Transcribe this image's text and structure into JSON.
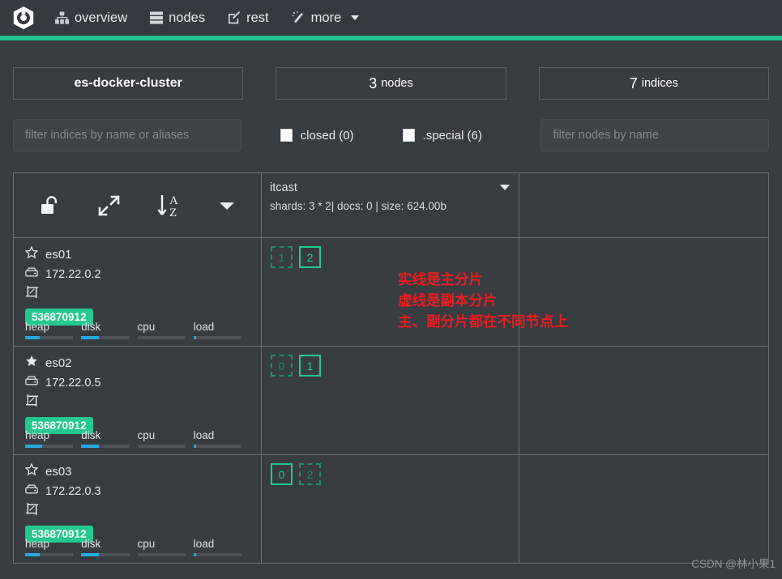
{
  "header": {
    "logo_alt": "cerebro-logo",
    "nav": [
      {
        "icon": "sitemap-icon",
        "label": "overview"
      },
      {
        "icon": "server-list-icon",
        "label": "nodes"
      },
      {
        "icon": "edit-square-icon",
        "label": "rest"
      },
      {
        "icon": "magic-wand-icon",
        "label": "more",
        "has_caret": true
      }
    ],
    "accent_color": "#1cbf8d"
  },
  "stats": {
    "cluster_name": "es-docker-cluster",
    "nodes_count": "3",
    "nodes_label": "nodes",
    "indices_count": "7",
    "indices_label": "indices"
  },
  "filters": {
    "indices_placeholder": "filter indices by name or aliases",
    "nodes_placeholder": "filter nodes by name",
    "indices_value": "",
    "nodes_value": "",
    "checkboxes": [
      {
        "label": "closed (0)",
        "checked": false
      },
      {
        "label": ".special (6)",
        "checked": false
      }
    ]
  },
  "toolbar": {
    "buttons": [
      {
        "icon": "unlock-icon",
        "name": "toggle-lock-button"
      },
      {
        "icon": "expand-arrows-icon",
        "name": "expand-button"
      },
      {
        "icon": "sort-az-icon",
        "name": "sort-az-button"
      },
      {
        "icon": "caret-down-icon",
        "name": "more-options-button"
      }
    ]
  },
  "index": {
    "name": "itcast",
    "meta": "shards: 3 * 2| docs: 0 | size: 624.00b"
  },
  "nodes": [
    {
      "name": "es01",
      "ip": "172.22.0.2",
      "is_master": false,
      "memory": "536870912",
      "metrics": [
        {
          "label": "heap",
          "pct": 30
        },
        {
          "label": "disk",
          "pct": 36
        },
        {
          "label": "cpu",
          "pct": 0
        },
        {
          "label": "load",
          "pct": 6
        }
      ],
      "shards": [
        {
          "id": "1",
          "type": "replica"
        },
        {
          "id": "2",
          "type": "primary"
        }
      ]
    },
    {
      "name": "es02",
      "ip": "172.22.0.5",
      "is_master": true,
      "memory": "536870912",
      "metrics": [
        {
          "label": "heap",
          "pct": 36
        },
        {
          "label": "disk",
          "pct": 36
        },
        {
          "label": "cpu",
          "pct": 0
        },
        {
          "label": "load",
          "pct": 6
        }
      ],
      "shards": [
        {
          "id": "0",
          "type": "replica"
        },
        {
          "id": "1",
          "type": "primary"
        }
      ]
    },
    {
      "name": "es03",
      "ip": "172.22.0.3",
      "is_master": false,
      "memory": "536870912",
      "metrics": [
        {
          "label": "heap",
          "pct": 30
        },
        {
          "label": "disk",
          "pct": 36
        },
        {
          "label": "cpu",
          "pct": 0
        },
        {
          "label": "load",
          "pct": 6
        }
      ],
      "shards": [
        {
          "id": "0",
          "type": "primary"
        },
        {
          "id": "2",
          "type": "replica"
        }
      ]
    }
  ],
  "annotation": {
    "color": "#ee1c20",
    "lines": [
      "实线是主分片",
      "虚线是副本分片",
      "主、副分片都在不同节点上"
    ]
  },
  "watermark": "CSDN @林小果1",
  "colors": {
    "page_bg": "#373c40",
    "navbar_bg": "#343a40",
    "accent_green": "#1cbf8d",
    "primary_shard": "#20c98f",
    "replica_shard": "#1f8f6b",
    "metric_bar": "#27a9e1",
    "badge_bg": "#24c88f"
  }
}
